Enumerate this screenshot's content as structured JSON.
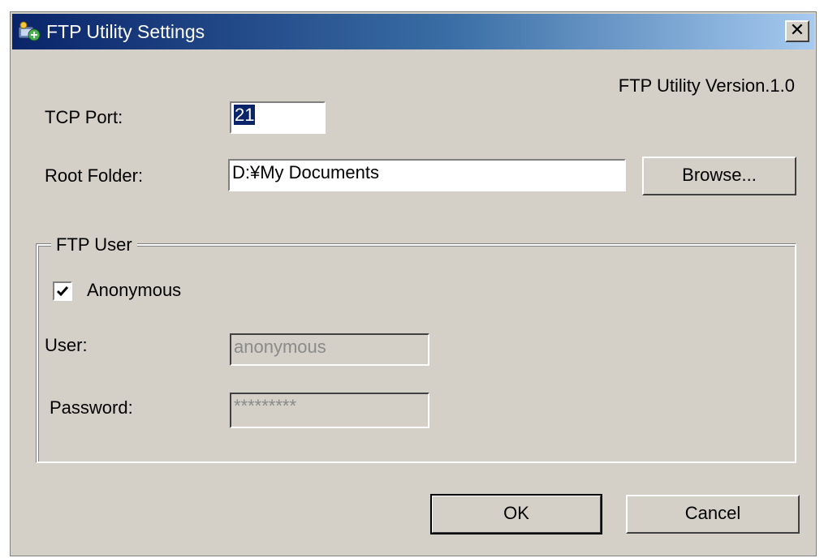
{
  "window": {
    "title": "FTP Utility Settings",
    "close_label": "✕"
  },
  "version_text": "FTP Utility Version.1.0",
  "tcp_port": {
    "label": "TCP Port:",
    "value": "21"
  },
  "root_folder": {
    "label": "Root Folder:",
    "value": "D:¥My Documents",
    "browse_label": "Browse..."
  },
  "ftp_user": {
    "group_label": "FTP User",
    "anonymous": {
      "label": "Anonymous",
      "checked": true
    },
    "user": {
      "label": "User:",
      "value": "anonymous"
    },
    "password": {
      "label": "Password:",
      "value": "*********"
    }
  },
  "buttons": {
    "ok_label": "OK",
    "cancel_label": "Cancel"
  },
  "icons": {
    "app": "ftp-app-icon",
    "close": "close-icon",
    "check": "checkmark-icon"
  },
  "colors": {
    "title_start": "#0a246a",
    "title_end": "#a6caf0",
    "dialog_bg": "#d4d0c8",
    "selection": "#0a246a"
  }
}
